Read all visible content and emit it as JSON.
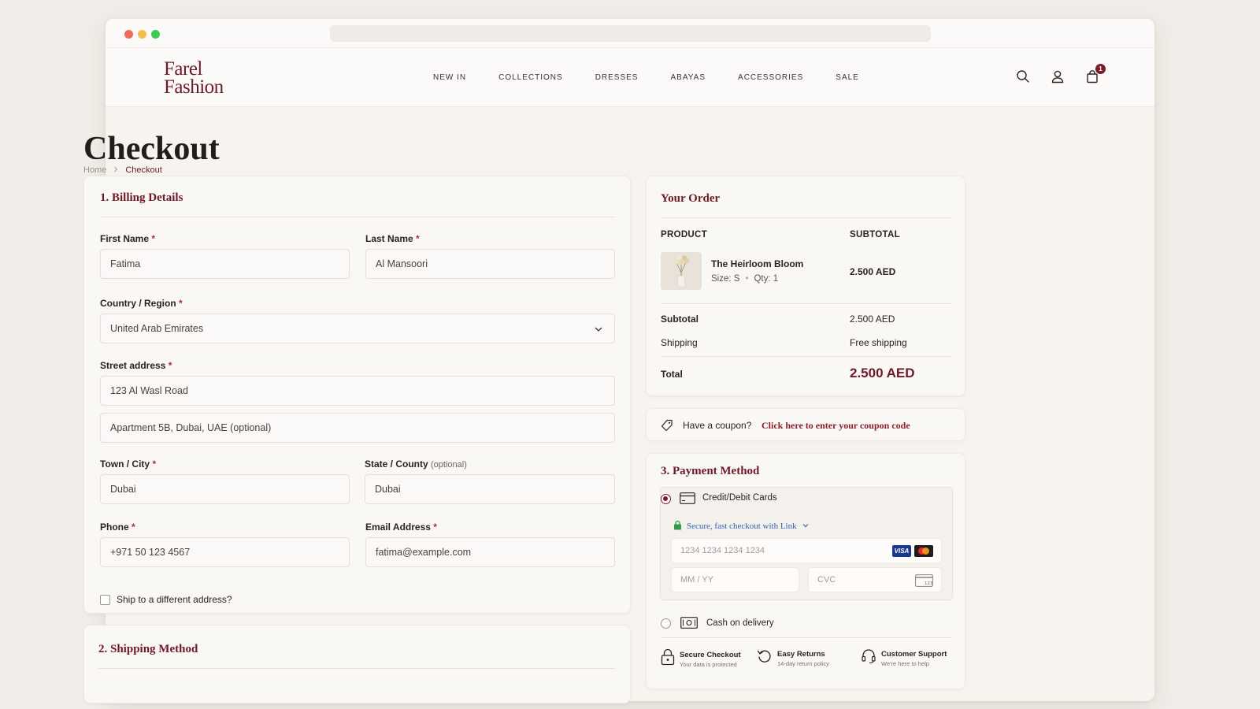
{
  "brand": {
    "line1": "Farel",
    "line2": "Fashion",
    "color": "#6e1a26"
  },
  "nav": [
    "NEW IN",
    "COLLECTIONS",
    "DRESSES",
    "ABAYAS",
    "ACCESSORIES",
    "SALE"
  ],
  "header_icons": {
    "search": "search-icon",
    "account": "user-icon",
    "cart": "bag-icon",
    "cart_count": "1"
  },
  "page": {
    "title": "Checkout",
    "breadcrumb": [
      "Home",
      "Checkout"
    ]
  },
  "billing": {
    "title": "1. Billing Details",
    "first_name_label": "First Name",
    "first_name": "Fatima",
    "last_name_label": "Last Name",
    "last_name": "Al Mansoori",
    "country_label": "Country / Region",
    "country": "United Arab Emirates",
    "street_label": "Street address",
    "street1": "123 Al Wasl Road",
    "street2_placeholder": "Apartment 5B, Dubai, UAE (optional)",
    "city_label": "Town / City",
    "city": "Dubai",
    "state_label": "State / County",
    "state_opt": "(optional)",
    "state": "Dubai",
    "phone_label": "Phone",
    "phone": "+971 50 123 4567",
    "email_label": "Email Address",
    "email": "fatima@example.com",
    "ship_diff": "Ship to a different address?",
    "req": "*"
  },
  "shipping": {
    "title": "2. Shipping Method"
  },
  "order": {
    "title": "Your Order",
    "col_product": "PRODUCT",
    "col_subtotal": "SUBTOTAL",
    "item_name": "The Heirloom Bloom",
    "item_size": "Size: S",
    "item_qty": "Qty: 1",
    "item_price": "2.500 AED",
    "subtotal_label": "Subtotal",
    "subtotal": "2.500 AED",
    "shipping_label": "Shipping",
    "shipping": "Free shipping",
    "total_label": "Total",
    "total": "2.500 AED"
  },
  "coupon": {
    "text": "Have a coupon?",
    "link": "Click here to enter your coupon code"
  },
  "payment": {
    "title": "3. Payment Method",
    "card_label": "Credit/Debit Cards",
    "link_text": "Secure, fast checkout with Link",
    "card_number_placeholder": "1234 1234 1234 1234",
    "expiry_placeholder": "MM / YY",
    "cvc_placeholder": "CVC",
    "visa": "VISA",
    "cod_label": "Cash on delivery",
    "trust": [
      {
        "title": "Secure Checkout",
        "sub": "Your data is protected"
      },
      {
        "title": "Easy Returns",
        "sub": "14-day return policy"
      },
      {
        "title": "Customer Support",
        "sub": "We're here to help"
      }
    ]
  }
}
